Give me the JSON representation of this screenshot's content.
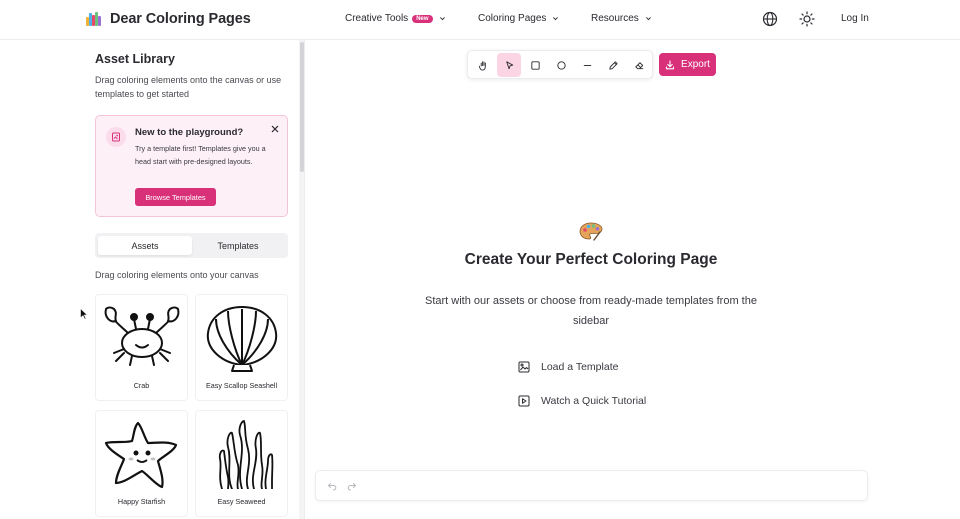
{
  "header": {
    "logo_text": "Dear Coloring Pages",
    "nav": [
      {
        "label": "Creative Tools",
        "badge": "New"
      },
      {
        "label": "Coloring Pages"
      },
      {
        "label": "Resources"
      }
    ],
    "icons": [
      "globe-icon",
      "sun-icon"
    ],
    "login_label": "Log In",
    "logo_colors": [
      "#f2b134",
      "#4fb0e8",
      "#e8496a",
      "#6cc27a",
      "#9a6fd8"
    ]
  },
  "sidebar": {
    "title": "Asset Library",
    "description": "Drag coloring elements onto the canvas or use templates to get started",
    "promo": {
      "title": "New to the playground?",
      "text": "Try a template first! Templates give you a head start with pre-designed layouts.",
      "button_label": "Browse Templates"
    },
    "tabs": [
      "Assets",
      "Templates"
    ],
    "active_tab": "Assets",
    "drag_hint": "Drag coloring elements onto your canvas",
    "assets": [
      {
        "label": "Crab",
        "icon": "crab-icon"
      },
      {
        "label": "Easy Scallop Seashell",
        "icon": "seashell-icon"
      },
      {
        "label": "Happy Starfish",
        "icon": "starfish-icon"
      },
      {
        "label": "Easy Seaweed",
        "icon": "seaweed-icon"
      }
    ]
  },
  "toolbar": {
    "tools": [
      "hand-icon",
      "pointer-icon",
      "rectangle-icon",
      "circle-icon",
      "line-icon",
      "pencil-icon",
      "eraser-icon"
    ],
    "active_tool": "pointer-icon",
    "export_label": "Export"
  },
  "canvas": {
    "title": "Create Your Perfect Coloring Page",
    "subtitle": "Start with our assets or choose from ready-made templates from the sidebar",
    "actions": [
      {
        "label": "Load a Template",
        "icon": "image-icon"
      },
      {
        "label": "Watch a Quick Tutorial",
        "icon": "play-icon"
      }
    ]
  },
  "colors": {
    "accent": "#d9307a",
    "accent_soft": "#fbd5e3",
    "promo_bg": "#fdf0f6"
  }
}
